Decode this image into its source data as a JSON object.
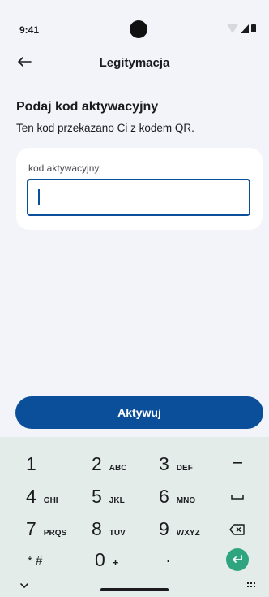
{
  "status": {
    "time": "9:41"
  },
  "header": {
    "title": "Legitymacja"
  },
  "main": {
    "heading": "Podaj kod aktywacyjny",
    "subtext": "Ten kod przekazano Ci z kodem QR.",
    "field_label": "kod aktywacyjny",
    "field_value": ""
  },
  "actions": {
    "activate_label": "Aktywuj"
  },
  "keyboard": {
    "keys": [
      {
        "num": "1",
        "letters": ""
      },
      {
        "num": "2",
        "letters": "ABC"
      },
      {
        "num": "3",
        "letters": "DEF"
      },
      {
        "num": "4",
        "letters": "GHI"
      },
      {
        "num": "5",
        "letters": "JKL"
      },
      {
        "num": "6",
        "letters": "MNO"
      },
      {
        "num": "7",
        "letters": "PRQS"
      },
      {
        "num": "8",
        "letters": "TUV"
      },
      {
        "num": "9",
        "letters": "WXYZ"
      },
      {
        "num": "* #",
        "letters": ""
      },
      {
        "num": "0",
        "letters": "+"
      },
      {
        "num": ".",
        "letters": ""
      }
    ],
    "icons": [
      "minus-icon",
      "space-icon",
      "backspace-icon",
      "enter-icon",
      "chevron-down-icon",
      "keyboard-switch-icon"
    ]
  },
  "colors": {
    "accent": "#0b4e9a",
    "enter_key": "#2ea57e",
    "background": "#f3f4f9",
    "keyboard_bg": "#e3ece9"
  }
}
